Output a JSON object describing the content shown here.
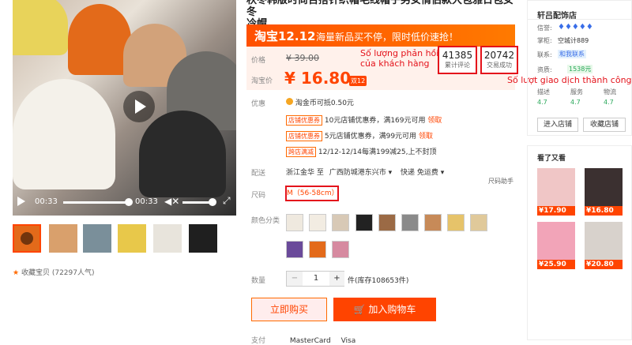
{
  "video": {
    "time_current": "00:33",
    "time_total": "00:33"
  },
  "favorite": {
    "label": "收藏宝贝",
    "count": "(72297人气)"
  },
  "title": {
    "line1": "秋冬韩版时尚百搭针织帽毛线帽子男女情侣款大包雅日包女冬",
    "line2": "冷帽"
  },
  "promo": {
    "logo": "淘宝12.12",
    "text": "海量新品买不停，限时低价速抢！"
  },
  "price": {
    "old_label": "价格",
    "old_value": "¥ 39.00",
    "cur_label": "淘宝价",
    "cur_value": "¥ 16.80",
    "badge": "双12"
  },
  "stats": {
    "reviews_count": "41385",
    "reviews_label": "累计评论",
    "transactions_count": "20742",
    "transactions_label": "交易成功",
    "annotation_reviews_1": "Số lượng phản hồi",
    "annotation_reviews_2": "của khách hàng",
    "annotation_transactions": "Số lượt giao dịch thành công"
  },
  "offers": {
    "label": "优惠",
    "coin": "淘金币可抵0.50元",
    "coupon1_tag": "店铺优惠券",
    "coupon1_text": "10元店铺优惠券，满169元可用",
    "coupon1_link": "领取",
    "coupon2_tag": "店铺优惠券",
    "coupon2_text": "5元店铺优惠券，满99元可用",
    "coupon2_link": "领取",
    "full_tag": "跨店满减",
    "full_text": "12/12-12/14每满199减25,上不封顶"
  },
  "delivery": {
    "label": "配送",
    "from": "浙江金华 至",
    "to": "广西防城港东兴市",
    "express": "快递 免运费",
    "size_helper": "尺码助手"
  },
  "size": {
    "label": "尺码",
    "value": "M（56-58cm）"
  },
  "color": {
    "label": "颜色分类"
  },
  "quantity": {
    "label": "数量",
    "value": "1",
    "stock": "件(库存108653件)",
    "minus": "−",
    "plus": "+"
  },
  "buttons": {
    "buy": "立即购买",
    "cart": "加入购物车"
  },
  "payment": {
    "label": "支付",
    "mastercard": "MasterCard",
    "visa": "Visa"
  },
  "shop": {
    "name": "轩吕配饰店",
    "credit_label": "信誉:",
    "keeper_label": "掌柜:",
    "keeper": "空城计889",
    "contact_label": "联系:",
    "contact": "和我联系",
    "qual_label": "资质:",
    "qual_value": "1538元",
    "desc_label": "描述",
    "service_label": "服务",
    "logistics_label": "物流",
    "desc_score": "4.7",
    "service_score": "4.7",
    "logistics_score": "4.7",
    "enter_btn": "进入店铺",
    "collect_btn": "收藏店铺"
  },
  "seen": {
    "title": "看了又看",
    "prices": [
      "¥17.90",
      "¥16.80",
      "¥25.90",
      "¥20.80"
    ]
  },
  "colors": {
    "accent": "#ff4400",
    "annotation": "#e4131b",
    "promo": "#ff5000"
  }
}
